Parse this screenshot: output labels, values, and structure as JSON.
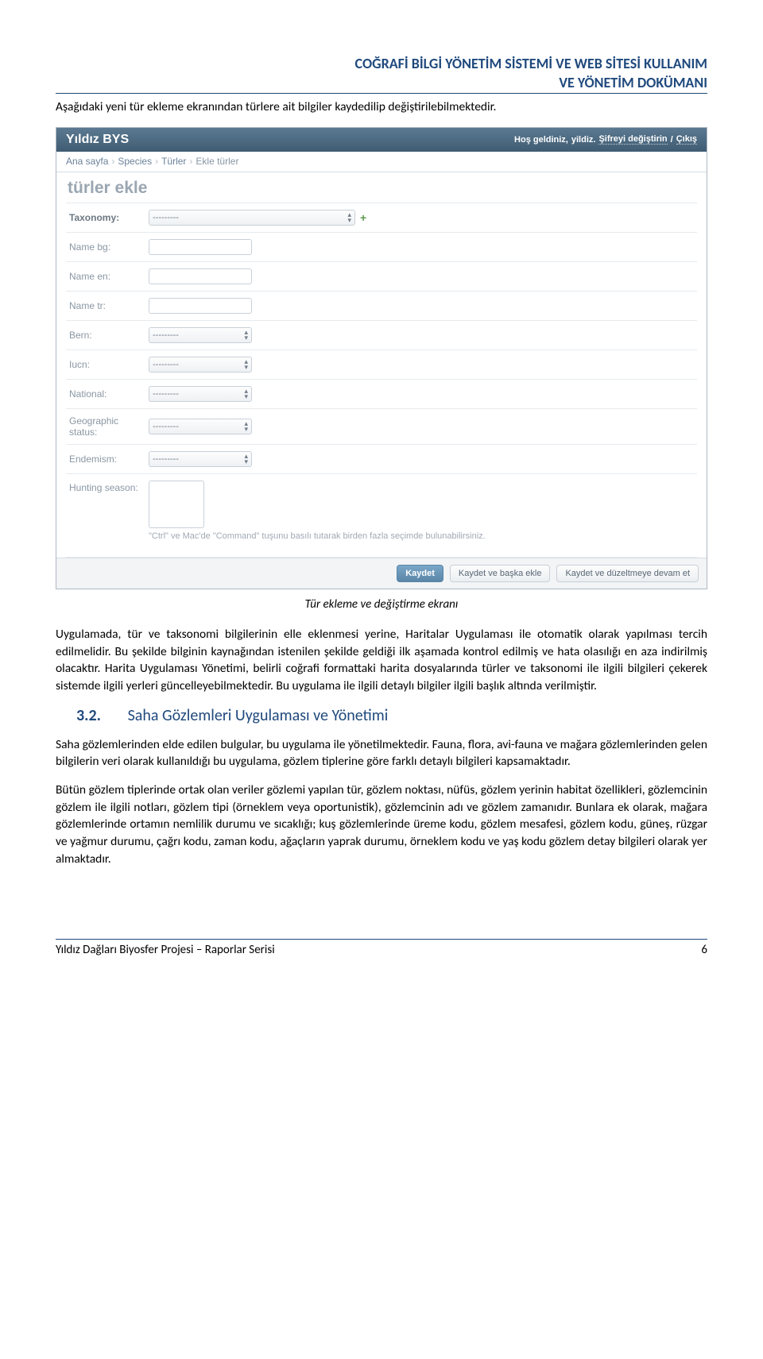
{
  "doc": {
    "header_line1": "COĞRAFİ BİLGİ YÖNETİM SİSTEMİ VE WEB SİTESİ KULLANIM",
    "header_line2": "VE YÖNETİM DOKÜMANI",
    "intro": "Aşağıdaki yeni tür ekleme ekranından türlere ait bilgiler kaydedilip değiştirilebilmektedir.",
    "caption": "Tür ekleme ve değiştirme ekranı",
    "body1": "Uygulamada, tür ve taksonomi bilgilerinin elle eklenmesi yerine, Haritalar Uygulaması ile otomatik olarak yapılması tercih edilmelidir. Bu şekilde bilginin kaynağından istenilen şekilde geldiği ilk aşamada kontrol edilmiş ve hata olasılığı en aza indirilmiş olacaktır. Harita Uygulaması Yönetimi, belirli coğrafi formattaki harita dosyalarında türler ve taksonomi ile ilgili bilgileri çekerek sistemde ilgili yerleri güncelleyebilmektedir. Bu uygulama ile ilgili detaylı bilgiler ilgili başlık altında verilmiştir.",
    "section_num": "3.2.",
    "section_title": "Saha Gözlemleri Uygulaması ve Yönetimi",
    "body2": "Saha gözlemlerinden elde edilen bulgular, bu uygulama ile yönetilmektedir. Fauna, flora, avi-fauna ve mağara gözlemlerinden gelen bilgilerin veri olarak kullanıldığı bu uygulama, gözlem tiplerine göre farklı detaylı bilgileri kapsamaktadır.",
    "body3": "Bütün gözlem tiplerinde ortak olan veriler gözlemi yapılan tür, gözlem noktası, nüfüs, gözlem yerinin habitat özellikleri, gözlemcinin gözlem ile ilgili notları, gözlem tipi (örneklem veya oportunistik), gözlemcinin adı ve gözlem zamanıdır. Bunlara ek olarak, mağara gözlemlerinde ortamın nemlilik durumu ve sıcaklığı; kuş gözlemlerinde üreme kodu, gözlem mesafesi, gözlem kodu, güneş, rüzgar ve yağmur durumu, çağrı kodu, zaman kodu, ağaçların yaprak durumu, örneklem kodu ve yaş kodu gözlem detay bilgileri olarak yer almaktadır.",
    "footer_left": "Yıldız Dağları Biyosfer Projesi – Raporlar Serisi",
    "footer_right": "6"
  },
  "shot": {
    "brand": "Yıldız BYS",
    "welcome": "Hoş geldiniz,",
    "user": "yildiz.",
    "change_pw": "Şifreyi değiştirin",
    "logout": "Çıkış",
    "sep": "/",
    "crumb_home": "Ana sayfa",
    "crumb_1": "Species",
    "crumb_2": "Türler",
    "crumb_3": "Ekle türler",
    "page_title": "türler ekle",
    "labels": {
      "taxonomy": "Taxonomy:",
      "name_bg": "Name bg:",
      "name_en": "Name en:",
      "name_tr": "Name tr:",
      "bern": "Bern:",
      "iucn": "Iucn:",
      "national": "National:",
      "geo": "Geographic status:",
      "endemism": "Endemism:",
      "hunting": "Hunting season:"
    },
    "dashes": "---------",
    "help": "\"Ctrl\" ve Mac'de \"Command\" tuşunu basılı tutarak birden fazla seçimde bulunabilirsiniz.",
    "buttons": {
      "save": "Kaydet",
      "save_another": "Kaydet ve başka ekle",
      "save_continue": "Kaydet ve düzeltmeye devam et"
    }
  }
}
